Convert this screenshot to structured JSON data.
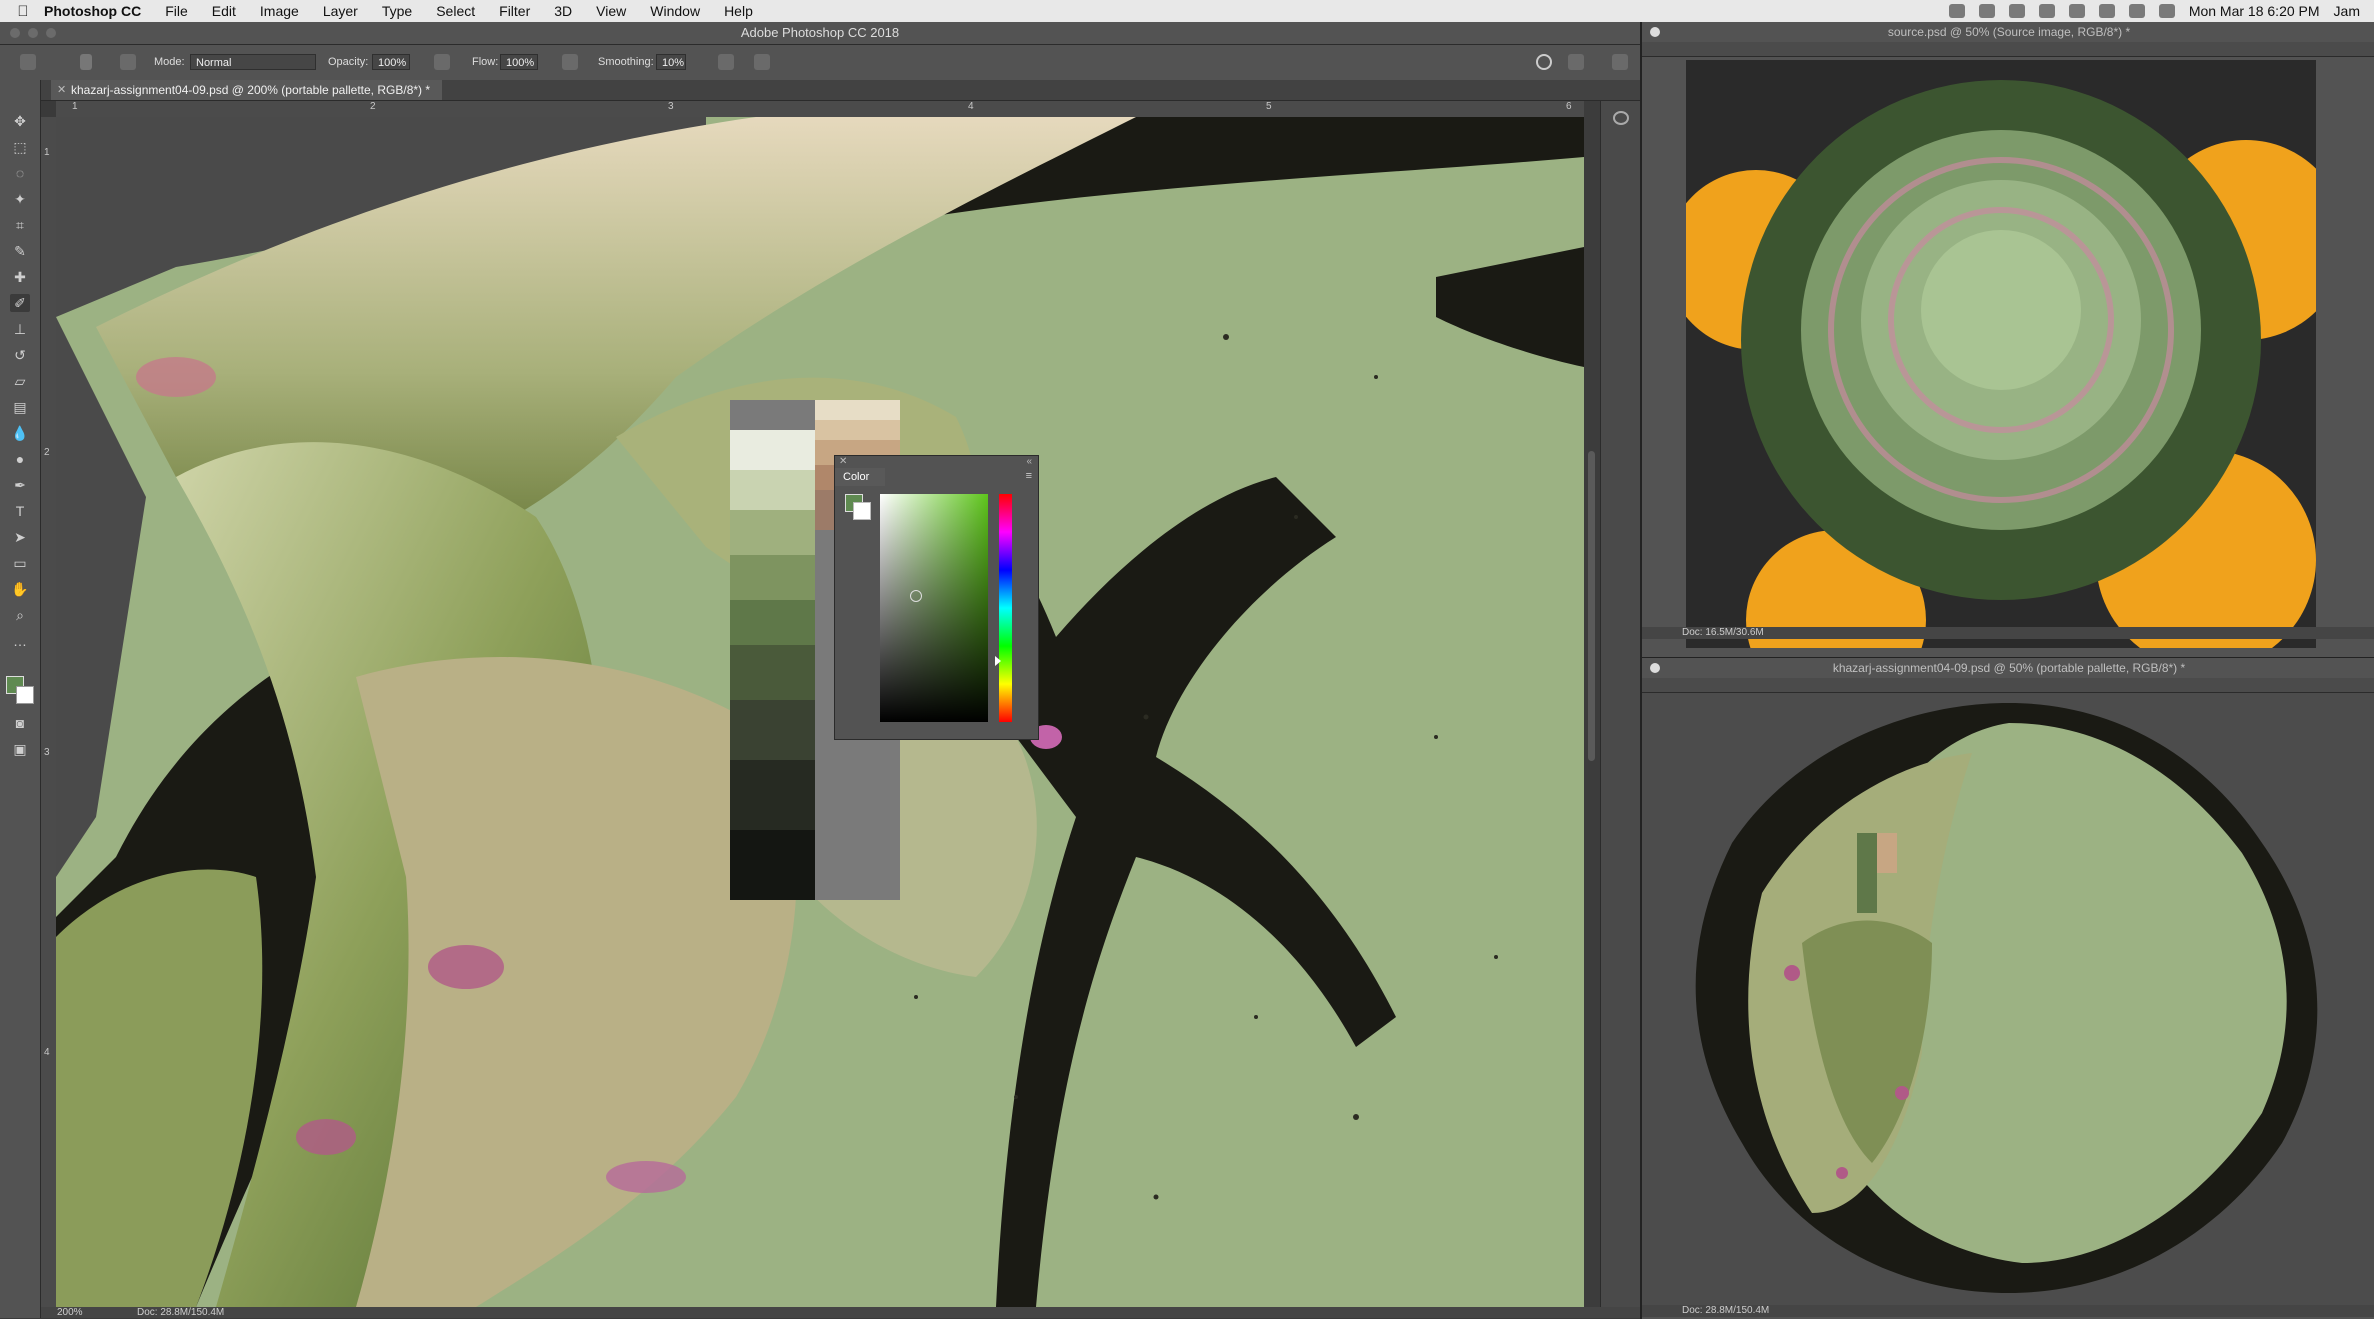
{
  "menubar": {
    "app_name": "Photoshop CC",
    "menus": [
      "File",
      "Edit",
      "Image",
      "Layer",
      "Type",
      "Select",
      "Filter",
      "3D",
      "View",
      "Window",
      "Help"
    ],
    "clock": "Mon Mar 18  6:20 PM",
    "user": "Jam"
  },
  "window": {
    "title": "Adobe Photoshop CC 2018"
  },
  "options_bar": {
    "mode_label": "Mode:",
    "mode_value": "Normal",
    "opacity_label": "Opacity:",
    "opacity_value": "100%",
    "flow_label": "Flow:",
    "flow_value": "100%",
    "smoothing_label": "Smoothing:",
    "smoothing_value": "10%"
  },
  "document_tab": {
    "title": "khazarj-assignment04-09.psd @ 200% (portable pallette, RGB/8*) *"
  },
  "ruler_ticks": [
    "1",
    "2",
    "3",
    "4",
    "5",
    "6"
  ],
  "vruler_ticks": [
    "1",
    "2",
    "3",
    "4"
  ],
  "status_left": {
    "zoom": "200%",
    "doc": "Doc: 28.8M/150.4M"
  },
  "color_panel": {
    "title": "Color",
    "foreground": "#5f8a51",
    "background": "#ffffff"
  },
  "source_window": {
    "title": "source.psd @ 50% (Source image, RGB/8*) *",
    "doc": "Doc: 16.5M/30.6M"
  },
  "palette_window": {
    "title": "khazarj-assignment04-09.psd @ 50% (portable pallette, RGB/8*) *",
    "doc": "Doc: 28.8M/150.4M"
  },
  "colors": {
    "ui_panel": "#535353",
    "canvas_green": "#9cb283",
    "artichoke_dark": "#1a1a14",
    "orange": "#f0a21c"
  }
}
